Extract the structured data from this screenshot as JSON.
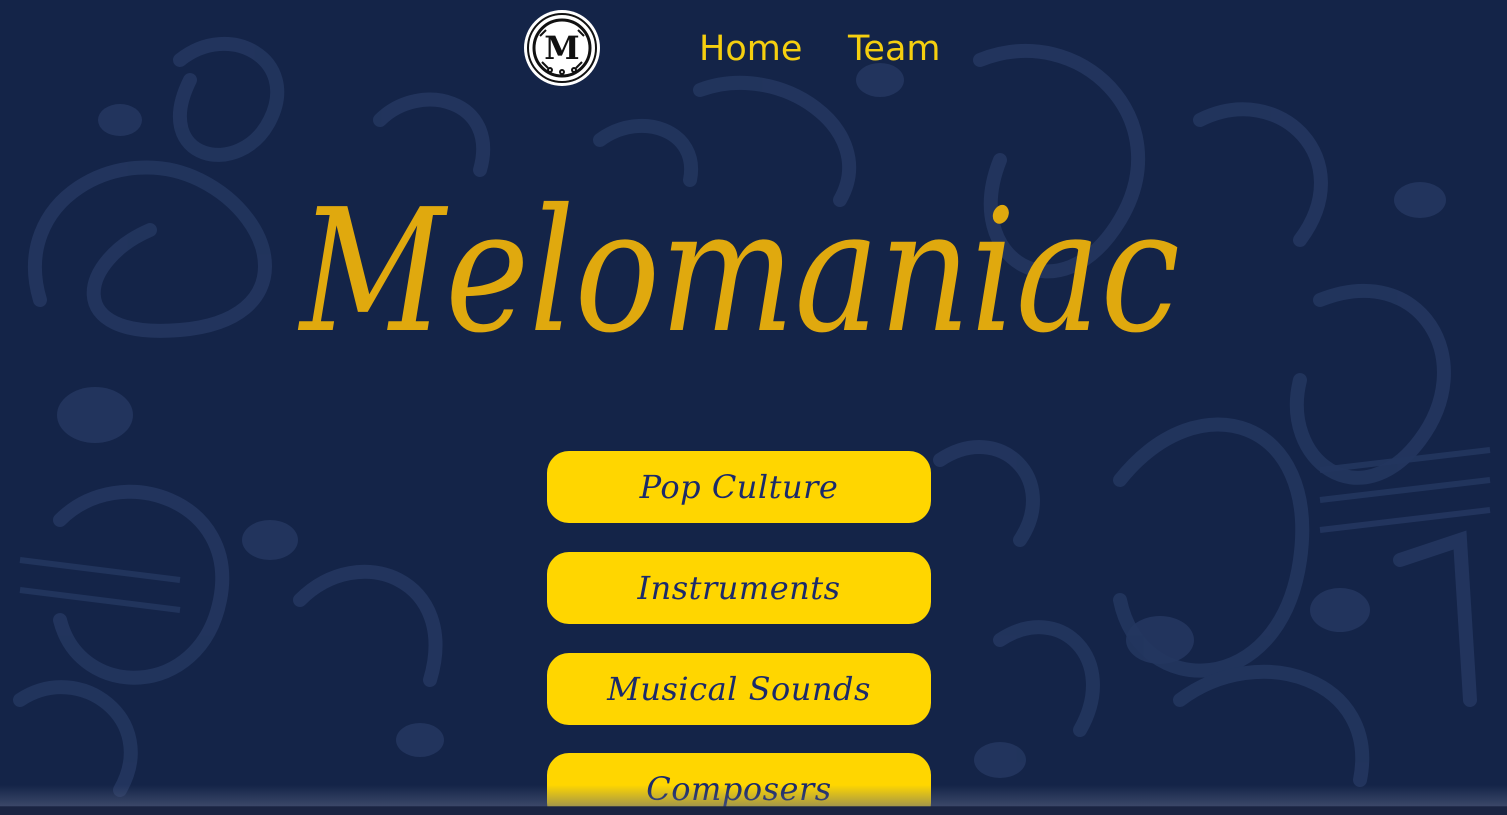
{
  "nav": {
    "logo_icon": "melomaniac-logo-icon",
    "links": [
      {
        "label": "Home"
      },
      {
        "label": "Team"
      }
    ]
  },
  "hero": {
    "title": "Melomaniac"
  },
  "categories": [
    {
      "label": "Pop Culture"
    },
    {
      "label": "Instruments"
    },
    {
      "label": "Musical Sounds"
    },
    {
      "label": "Composers"
    }
  ],
  "colors": {
    "background": "#142448",
    "pattern": "#23365f",
    "nav_text": "#f5cf0f",
    "title": "#e0a90e",
    "button_bg": "#ffd600",
    "button_text": "#1b2a6b"
  }
}
